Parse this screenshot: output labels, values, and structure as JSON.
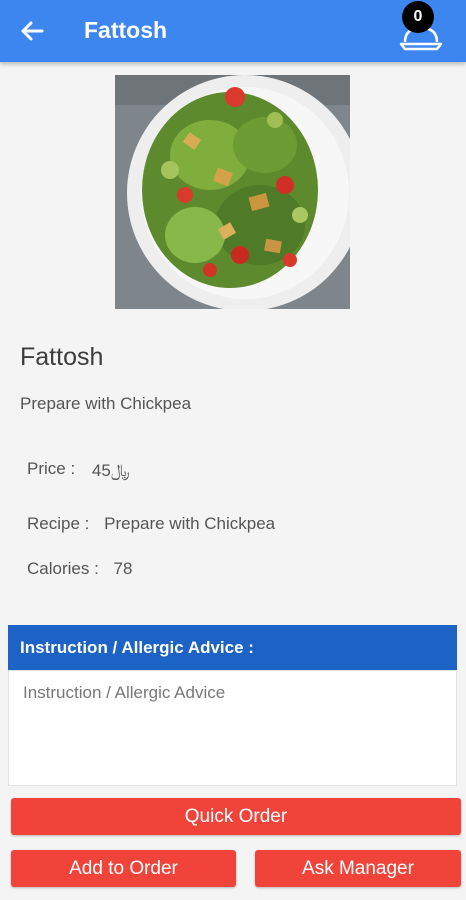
{
  "app_bar": {
    "title": "Fattosh",
    "back_icon": "arrow-left-icon",
    "cart_icon": "dish-tray-icon",
    "cart_count": "0",
    "background": "#3d86f0"
  },
  "dish": {
    "name": "Fattosh",
    "description": "Prepare with Chickpea",
    "image_icon": "fattoush-salad-photo"
  },
  "details": {
    "price_label": "Price :",
    "price_value": "45",
    "price_currency": "﷼",
    "recipe_label": "Recipe :",
    "recipe_value": "Prepare with Chickpea",
    "calories_label": "Calories :",
    "calories_value": "78"
  },
  "instructions": {
    "header": "Instruction / Allergic Advice :",
    "placeholder": "Instruction / Allergic Advice",
    "header_color": "#1d63c6"
  },
  "actions": {
    "quick_order": "Quick Order",
    "add_to_order": "Add to Order",
    "ask_manager": "Ask Manager",
    "button_color": "#f0443a"
  }
}
